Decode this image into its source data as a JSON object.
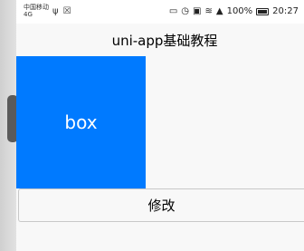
{
  "status_bar": {
    "carrier_line1": "中国移动",
    "carrier_line2": "4G",
    "left_icons": [
      "usb-icon",
      "notification-icon"
    ],
    "right_icons": [
      "cast-icon",
      "alarm-icon",
      "nfc-icon",
      "wifi-icon",
      "signal-icon"
    ],
    "battery": "100%",
    "time": "20:27"
  },
  "nav": {
    "title": "uni-app基础教程"
  },
  "box": {
    "label": "box",
    "color": "#007aff"
  },
  "button": {
    "label": "修改"
  }
}
